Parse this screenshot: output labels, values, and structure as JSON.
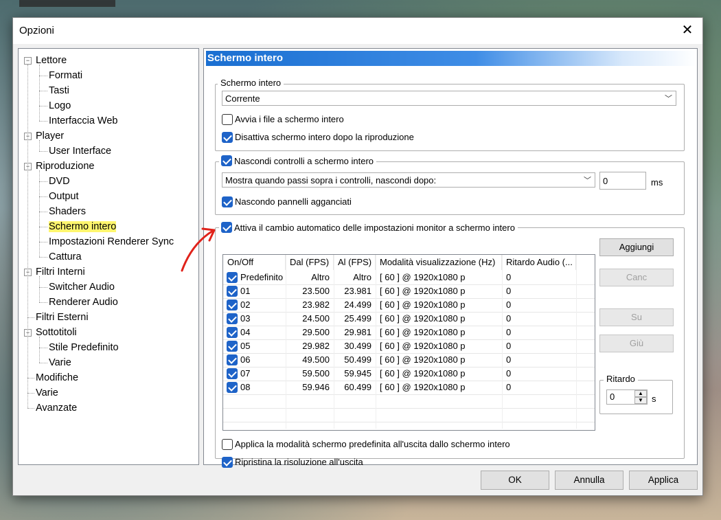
{
  "window": {
    "title": "Opzioni"
  },
  "tree": [
    {
      "label": "Lettore",
      "level": 0,
      "expander": "⊟"
    },
    {
      "label": "Formati",
      "level": 1
    },
    {
      "label": "Tasti",
      "level": 1
    },
    {
      "label": "Logo",
      "level": 1
    },
    {
      "label": "Interfaccia Web",
      "level": 1
    },
    {
      "label": "Player",
      "level": 0,
      "expander": "⊟"
    },
    {
      "label": "User Interface",
      "level": 1
    },
    {
      "label": "Riproduzione",
      "level": 0,
      "expander": "⊟"
    },
    {
      "label": "DVD",
      "level": 1
    },
    {
      "label": "Output",
      "level": 1
    },
    {
      "label": "Shaders",
      "level": 1
    },
    {
      "label": "Schermo intero",
      "level": 1,
      "selected": true
    },
    {
      "label": "Impostazioni Renderer Sync",
      "level": 1
    },
    {
      "label": "Cattura",
      "level": 1
    },
    {
      "label": "Filtri Interni",
      "level": 0,
      "expander": "⊟"
    },
    {
      "label": "Switcher Audio",
      "level": 1
    },
    {
      "label": "Renderer Audio",
      "level": 1
    },
    {
      "label": "Filtri Esterni",
      "level": 0
    },
    {
      "label": "Sottotitoli",
      "level": 0,
      "expander": "⊟"
    },
    {
      "label": "Stile Predefinito",
      "level": 1
    },
    {
      "label": "Varie",
      "level": 1
    },
    {
      "label": "Modifiche",
      "level": 0
    },
    {
      "label": "Varie",
      "level": 0
    },
    {
      "label": "Avanzate",
      "level": 0
    }
  ],
  "panel": {
    "header": "Schermo intero",
    "group1": {
      "legend": "Schermo intero",
      "combo": "Corrente",
      "cb_launch": {
        "label": "Avvia i file a schermo intero",
        "checked": false
      },
      "cb_disable": {
        "label": "Disattiva schermo intero dopo la riproduzione",
        "checked": true
      }
    },
    "group2": {
      "legend": "Nascondi controlli a schermo intero",
      "legend_checked": true,
      "combo": "Mostra quando passi sopra i controlli, nascondi dopo:",
      "delay_value": "0",
      "delay_unit": "ms",
      "cb_panels": {
        "label": "Nascondo pannelli agganciati",
        "checked": true
      }
    },
    "group3": {
      "legend": "Attiva il cambio automatico delle impostazioni monitor a schermo intero",
      "legend_checked": true,
      "columns": [
        "On/Off",
        "Dal (FPS)",
        "Al (FPS)",
        "Modalità visualizzazione (Hz)",
        "Ritardo Audio (..."
      ],
      "rows": [
        {
          "name": "Predefinito",
          "from": "Altro",
          "to": "Altro",
          "mode": "[ 60 ] @ 1920x1080 p",
          "delay": "0"
        },
        {
          "name": "01",
          "from": "23.500",
          "to": "23.981",
          "mode": "[ 60 ] @ 1920x1080 p",
          "delay": "0"
        },
        {
          "name": "02",
          "from": "23.982",
          "to": "24.499",
          "mode": "[ 60 ] @ 1920x1080 p",
          "delay": "0"
        },
        {
          "name": "03",
          "from": "24.500",
          "to": "25.499",
          "mode": "[ 60 ] @ 1920x1080 p",
          "delay": "0"
        },
        {
          "name": "04",
          "from": "29.500",
          "to": "29.981",
          "mode": "[ 60 ] @ 1920x1080 p",
          "delay": "0"
        },
        {
          "name": "05",
          "from": "29.982",
          "to": "30.499",
          "mode": "[ 60 ] @ 1920x1080 p",
          "delay": "0"
        },
        {
          "name": "06",
          "from": "49.500",
          "to": "50.499",
          "mode": "[ 60 ] @ 1920x1080 p",
          "delay": "0"
        },
        {
          "name": "07",
          "from": "59.500",
          "to": "59.945",
          "mode": "[ 60 ] @ 1920x1080 p",
          "delay": "0"
        },
        {
          "name": "08",
          "from": "59.946",
          "to": "60.499",
          "mode": "[ 60 ] @ 1920x1080 p",
          "delay": "0"
        }
      ],
      "buttons": {
        "add": "Aggiungi",
        "delete": "Canc",
        "up": "Su",
        "down": "Giù"
      },
      "ritardo": {
        "legend": "Ritardo",
        "value": "0",
        "unit": "s"
      },
      "cb_apply_default": {
        "label": "Applica la modalità schermo predefinita all'uscita dallo schermo intero",
        "checked": false
      },
      "cb_restore": {
        "label": "Ripristina la risoluzione all'uscita",
        "checked": true
      }
    }
  },
  "footer": {
    "ok": "OK",
    "cancel": "Annulla",
    "apply": "Applica"
  },
  "colors": {
    "accent": "#1e63c8",
    "highlight": "#fff66e",
    "annotation": "#e0221a"
  }
}
